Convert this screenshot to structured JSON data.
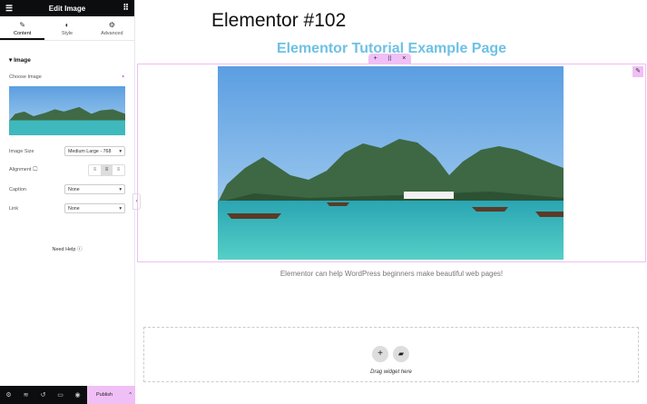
{
  "sidebar": {
    "title": "Edit Image",
    "tabs": [
      {
        "label": "Content",
        "icon": "pencil-icon"
      },
      {
        "label": "Style",
        "icon": "contrast-icon"
      },
      {
        "label": "Advanced",
        "icon": "gear-icon"
      }
    ],
    "section": "Image",
    "choose_image": "Choose Image",
    "image_size_label": "Image Size",
    "image_size": "Medium Large - 768",
    "alignment_label": "Alignment",
    "alignment": "center",
    "caption_label": "Caption",
    "caption": "None",
    "link_label": "Link",
    "link": "None",
    "need_help": "Need Help",
    "publish": "Publish"
  },
  "canvas": {
    "page_title": "Elementor #102",
    "heading": "Elementor Tutorial Example Page",
    "text": "Elementor can help WordPress beginners make beautiful web pages!",
    "drop_text": "Drag widget here"
  },
  "colors": {
    "accent": "#f0bff5",
    "heading": "#6ec1e4"
  }
}
